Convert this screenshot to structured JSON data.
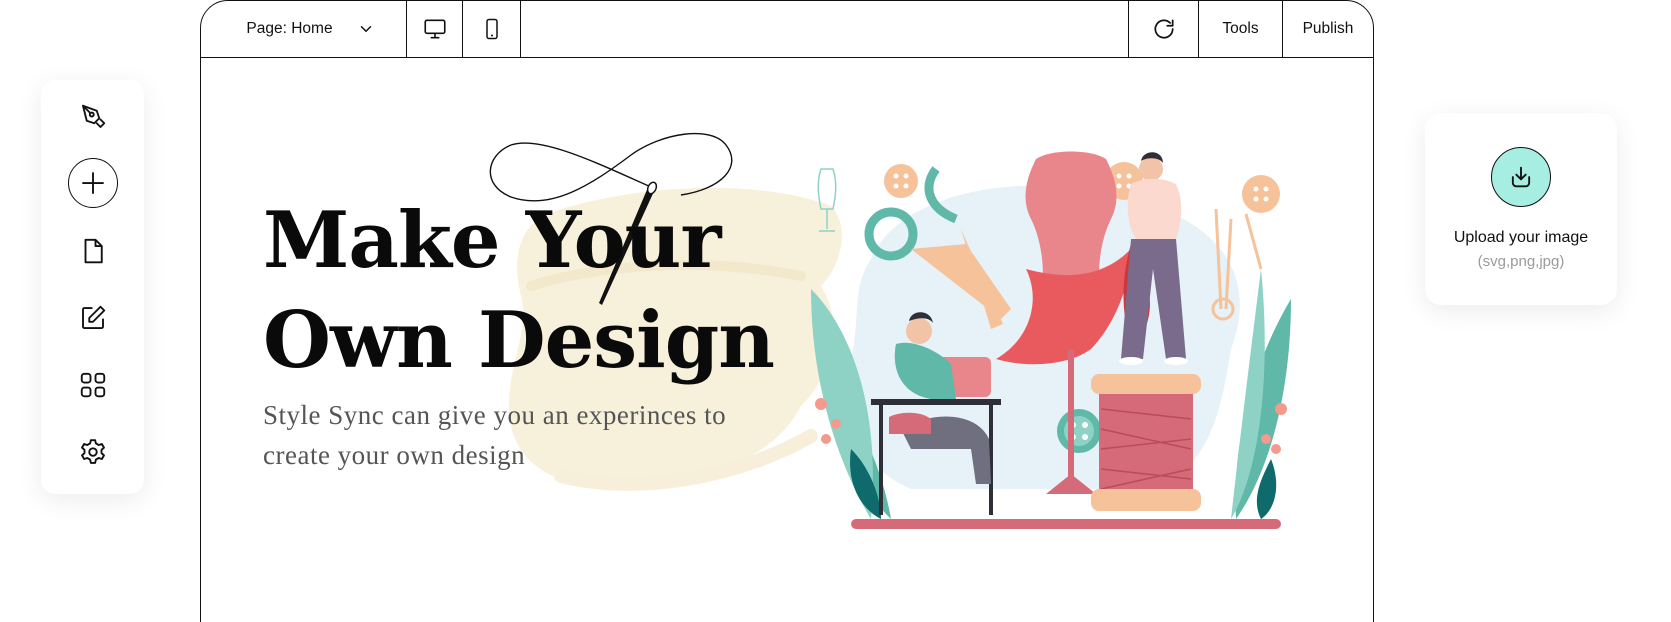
{
  "toolbar": {
    "page_label": "Page: Home",
    "tools_label": "Tools",
    "publish_label": "Publish"
  },
  "palette": {
    "items": [
      "pen-tool-icon",
      "add-icon",
      "file-icon",
      "edit-icon",
      "grid-icon",
      "settings-icon"
    ]
  },
  "hero": {
    "headline_line1": "Make Your",
    "headline_line2": "Own Design",
    "subtitle": "Style Sync can give you an experinces to create your own design"
  },
  "upload": {
    "title": "Upload your image",
    "types": "(svg,png,jpg)"
  },
  "colors": {
    "accent_mint": "#a5eee1",
    "brush_cream": "#f7efd9",
    "teal": "#5fb8a8",
    "coral": "#e85a5e"
  }
}
